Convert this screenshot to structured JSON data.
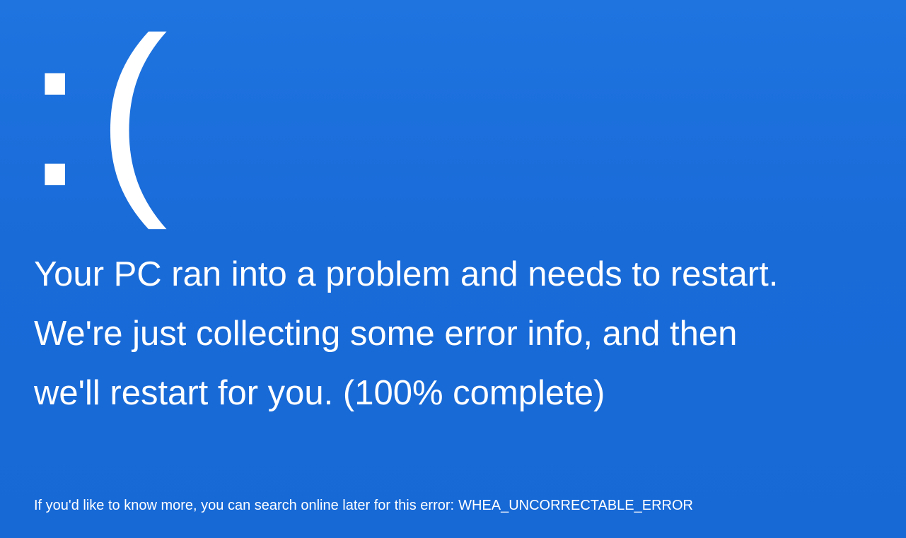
{
  "screen": {
    "background_color": "#1a6fdc",
    "text_color": "#ffffff",
    "icon": "sad-face-emoticon",
    "face": ":(",
    "message_lines": [
      "Your PC ran into a problem and needs to restart.",
      "We're just collecting some error info, and then",
      "we'll restart for you. (100% complete)"
    ],
    "footer_text": "If you'd like to know more, you can search online later for this error:",
    "stop_code": "WHEA_UNCORRECTABLE_ERROR"
  }
}
